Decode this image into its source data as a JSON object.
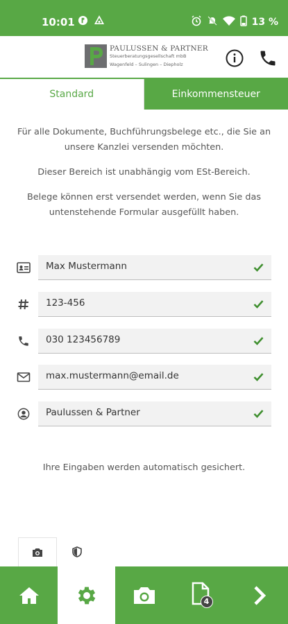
{
  "status_bar": {
    "time": "10:01",
    "battery": "13 %",
    "icons": [
      "app-icon",
      "cloud-icon",
      "alarm-icon",
      "mute-icon",
      "wifi-icon",
      "battery-icon"
    ]
  },
  "header": {
    "logo_title": "PAULUSSEN & PARTNER",
    "logo_subtitle": "Steuerberatungsgesellschaft mbB",
    "logo_places": "Wagenfeld – Sulingen – Diepholz",
    "info_icon": "info-icon",
    "phone_icon": "phone-icon"
  },
  "tabs": [
    {
      "label": "Standard",
      "active": true
    },
    {
      "label": "Einkommensteuer",
      "active": false
    }
  ],
  "info_texts": [
    "Für alle Dokumente, Buchführungsbelege etc., die Sie an unsere Kanzlei versenden möchten.",
    "Dieser Bereich ist unabhängig vom ESt-Bereich.",
    "Belege können erst versendet werden, wenn Sie das untenstehende Formular ausgefüllt haben."
  ],
  "form": {
    "fields": [
      {
        "icon": "id-card-icon",
        "value": "Max Mustermann"
      },
      {
        "icon": "hash-icon",
        "value": "123-456"
      },
      {
        "icon": "phone-icon",
        "value": "030 123456789"
      },
      {
        "icon": "mail-icon",
        "value": "max.mustermann@email.de"
      },
      {
        "icon": "account-icon",
        "value": "Paulussen & Partner"
      }
    ]
  },
  "autosave_text": "Ihre Eingaben werden automatisch gesichert.",
  "mini_tabs": [
    "camera-icon",
    "shield-icon"
  ],
  "bottom_nav": {
    "items": [
      "home-icon",
      "settings-icon",
      "camera-icon",
      "documents-icon",
      "next-icon"
    ],
    "document_count": "4"
  },
  "colors": {
    "brand_green": "#58a845",
    "check_green": "#3f8f2f"
  }
}
